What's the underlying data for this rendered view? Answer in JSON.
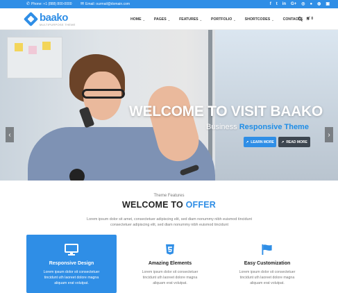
{
  "topbar": {
    "phone": "Phone: +1 (888) 800-0000",
    "email": "Email: ourmail@domain.com",
    "socials": [
      "f",
      "t",
      "in",
      "G+",
      "◎",
      "●",
      "◍",
      "▣"
    ]
  },
  "header": {
    "logo": "baako",
    "tagline": "MULTIPURPOSE THEME",
    "nav": [
      {
        "label": "HOME",
        "dropdown": true
      },
      {
        "label": "PAGES",
        "dropdown": true
      },
      {
        "label": "FEATURES",
        "dropdown": true
      },
      {
        "label": "PORTFOLIO",
        "dropdown": true
      },
      {
        "label": "SHORTCODES",
        "dropdown": true
      },
      {
        "label": "CONTACTS",
        "dropdown": false
      }
    ],
    "cart_count": "0"
  },
  "hero": {
    "title": "WELCOME TO VISIT BAAKO",
    "subtitle_plain": "Business ",
    "subtitle_accent": "Responsive Theme",
    "btn_learn": "LEARN MORE",
    "btn_read": "READ MORE",
    "prev": "‹",
    "next": "›"
  },
  "features": {
    "kicker": "Theme Features",
    "title_plain": "WELCOME TO ",
    "title_accent": "OFFER",
    "description": "Lorem ipsum dolor sit amet, consectetuer adipiscing elit, sed diam nonummy nibh euismod tincidunt consectetuer adipiscing elit, sed diam nonummy nibh euismod tincidunt",
    "cards": [
      {
        "title": "Responsive Design",
        "text": "Lorem ipsum dolor sit consectetuer tincidunt uth laoreet dolore magna aliquam erat volutpat."
      },
      {
        "title": "Amazing Elements",
        "text": "Lorem ipsum dolor sit consectetuer tincidunt uth laoreet dolore magna aliquam erat volutpat."
      },
      {
        "title": "Easy Customization",
        "text": "Lorem ipsum dolor sit consectetuer tincidunt uth laoreet dolore magna aliquam erat volutpat."
      }
    ]
  },
  "colors": {
    "accent": "#2f8ee6",
    "dark_button": "#3d4650"
  }
}
